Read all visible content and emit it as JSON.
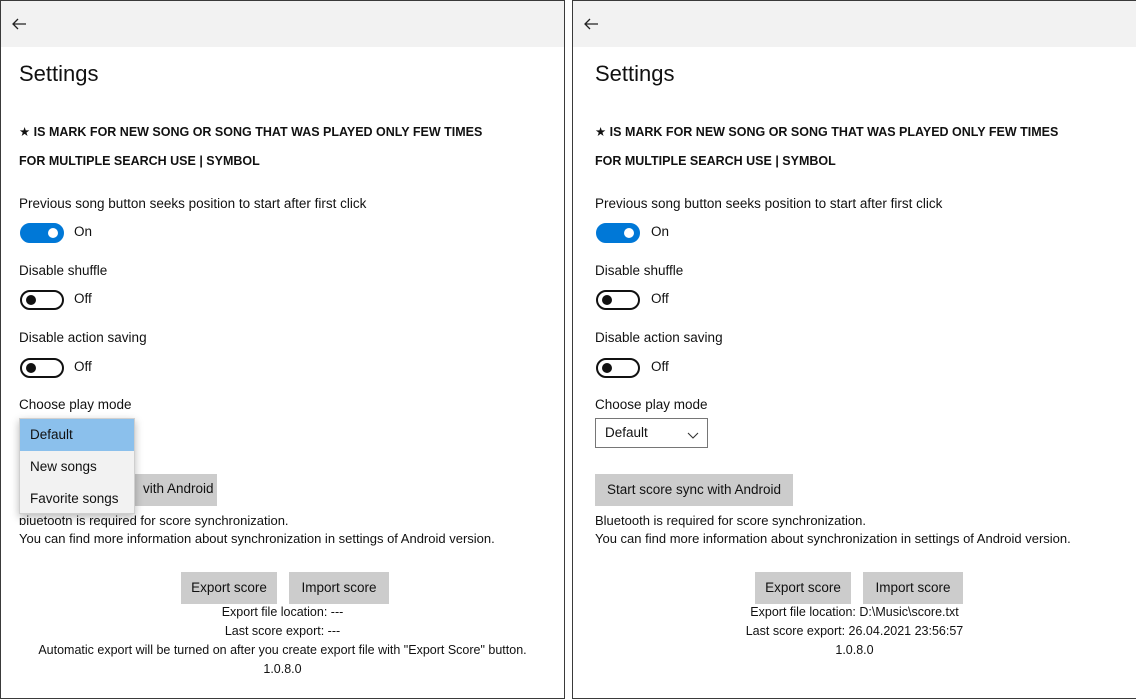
{
  "left": {
    "title": "Settings",
    "note_new_song": "★ IS MARK FOR NEW SONG OR SONG THAT WAS PLAYED ONLY FEW TIMES",
    "note_search": "FOR MULTIPLE SEARCH USE | SYMBOL",
    "prev_song_label": "Previous song button seeks position to start after first click",
    "prev_song_state": "On",
    "disable_shuffle_label": "Disable shuffle",
    "disable_shuffle_state": "Off",
    "disable_action_label": "Disable action saving",
    "disable_action_state": "Off",
    "play_mode_label": "Choose play mode",
    "play_mode_options": [
      "Default",
      "New songs",
      "Favorite songs"
    ],
    "sync_button_partial": "vith Android",
    "bluetooth_partial": "ɒiuetootn is required for score synchronization.",
    "more_info": "You can find more information about synchronization in settings of Android version.",
    "export_button": "Export score",
    "import_button": "Import score",
    "export_location": "Export file location: ---",
    "last_export": "Last score export: ---",
    "auto_export_note": "Automatic export will be turned on after you create export file with \"Export Score\" button.",
    "version": "1.0.8.0"
  },
  "right": {
    "title": "Settings",
    "note_new_song": "★ IS MARK FOR NEW SONG OR SONG THAT WAS PLAYED ONLY FEW TIMES",
    "note_search": "FOR MULTIPLE SEARCH USE | SYMBOL",
    "prev_song_label": "Previous song button seeks position to start after first click",
    "prev_song_state": "On",
    "disable_shuffle_label": "Disable shuffle",
    "disable_shuffle_state": "Off",
    "disable_action_label": "Disable action saving",
    "disable_action_state": "Off",
    "play_mode_label": "Choose play mode",
    "play_mode_value": "Default",
    "sync_button": "Start score sync with Android",
    "bluetooth": "Bluetooth is required for score synchronization.",
    "more_info": "You can find more information about synchronization in settings of Android version.",
    "export_button": "Export score",
    "import_button": "Import score",
    "export_location": "Export file location: D:\\Music\\score.txt",
    "last_export": "Last score export: 26.04.2021 23:56:57",
    "version": "1.0.8.0"
  },
  "colors": {
    "accent": "#0078d7",
    "titlebar": "#f2f2f2",
    "button": "#cccccc",
    "selected_item": "#8bc0ec"
  },
  "icons": {
    "back": "back-arrow-icon",
    "combo": "chevron-down-icon"
  }
}
